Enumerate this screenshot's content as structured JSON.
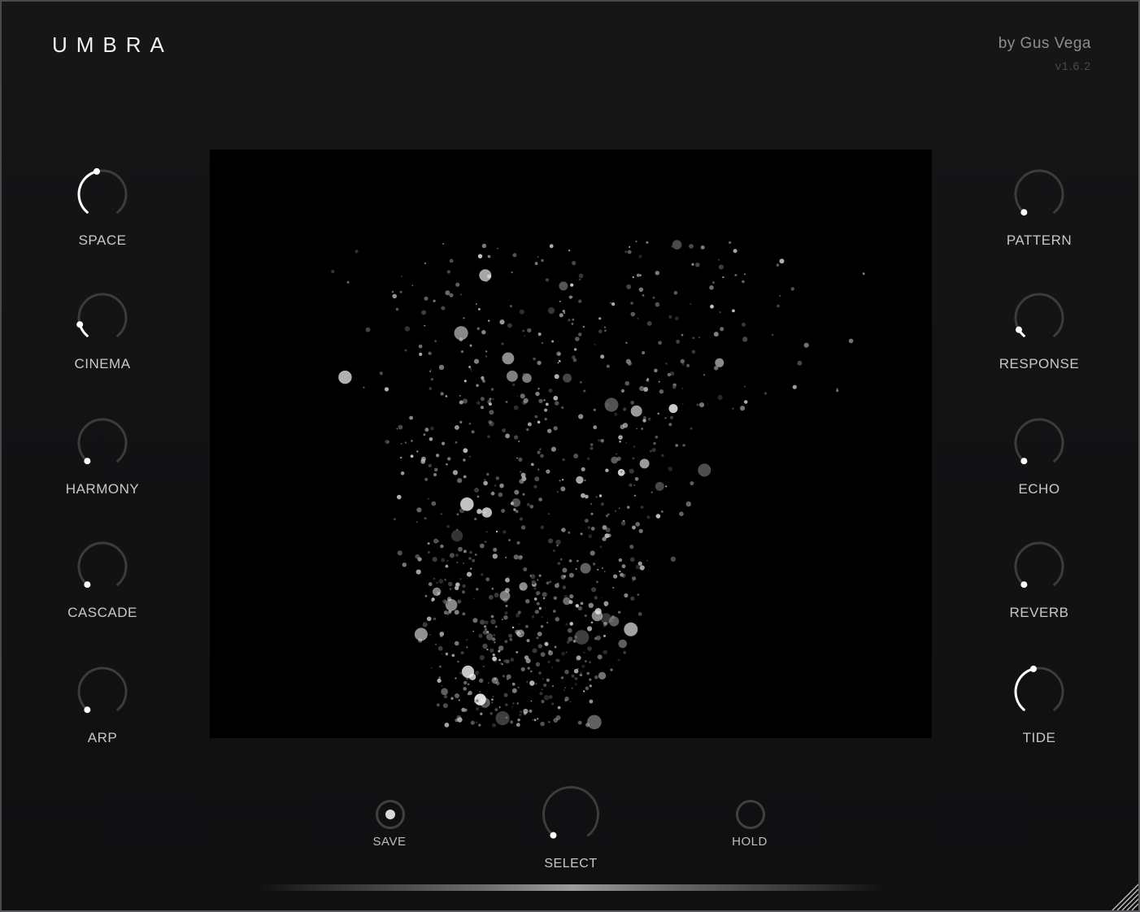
{
  "header": {
    "title": "UMBRA",
    "author": "by Gus Vega",
    "version": "v1.6.2"
  },
  "knobs_left": [
    {
      "label": "SPACE",
      "value": 0.45
    },
    {
      "label": "CINEMA",
      "value": 0.12
    },
    {
      "label": "HARMONY",
      "value": 0.0
    },
    {
      "label": "CASCADE",
      "value": 0.0
    },
    {
      "label": "ARP",
      "value": 0.0
    }
  ],
  "knobs_right": [
    {
      "label": "PATTERN",
      "value": 0.0
    },
    {
      "label": "RESPONSE",
      "value": 0.07
    },
    {
      "label": "ECHO",
      "value": 0.0
    },
    {
      "label": "REVERB",
      "value": 0.0
    },
    {
      "label": "TIDE",
      "value": 0.45
    }
  ],
  "footer": {
    "save_label": "SAVE",
    "select_label": "SELECT",
    "hold_label": "HOLD",
    "save_active": true,
    "hold_active": false,
    "select_value": 0.0
  },
  "colors": {
    "accent": "#ffffff",
    "track": "#3c3c3e",
    "background": "#131314",
    "visualizer": "#000000"
  }
}
